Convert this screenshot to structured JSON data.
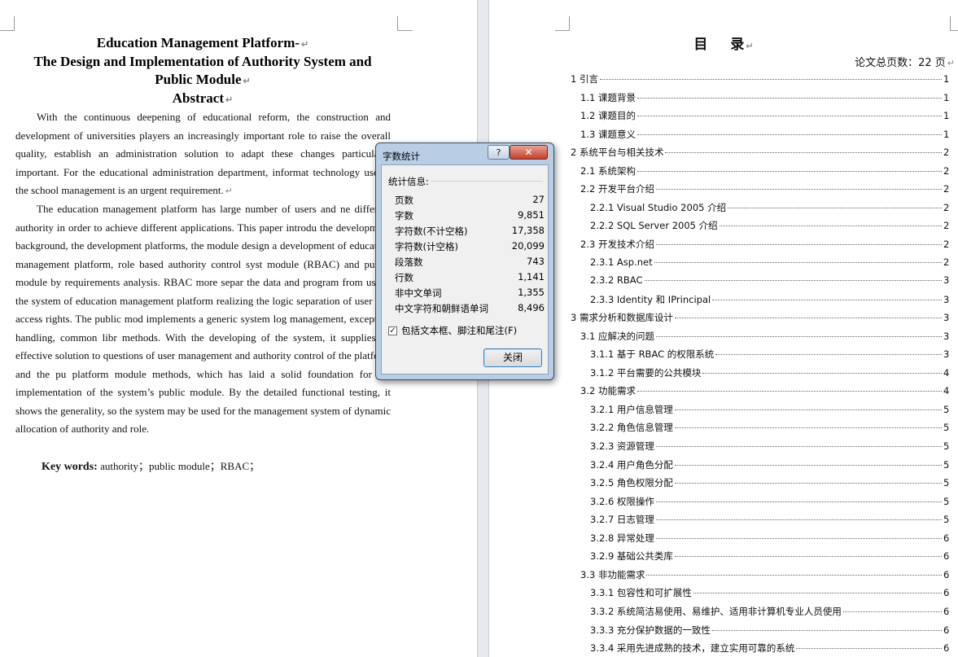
{
  "left_page": {
    "title_lines": [
      "Education Management Platform-",
      "The Design and Implementation of Authority System and",
      "Public Module"
    ],
    "abstract_heading": "Abstract",
    "paragraph1_lines": [
      "With the continuous deepening of educational reform, the construction and",
      "development of universities players an increasingly important role to raise the",
      "overall quality, establish an administration solution to adapt these changes",
      "particularly important. For the educational administration department, informat",
      "technology use in the school management is an urgent requirement."
    ],
    "paragraph2_lines": [
      "The education management platform has large number of users and ne",
      "different authority in order to achieve different applications. This paper introdu",
      "the development background, the development platforms, the module design a",
      "development of education management platform, role based authority control syst",
      "module (RBAC) and public module by requirements analysis. RBAC more separ",
      "the data and program from users, the system of education management platform",
      "realizing the logic separation of user and access rights. The public mod",
      "implements a generic system log management, exception handling, common libr",
      "methods. With the developing of the system, it supplies an effective solution to",
      "questions of user management and authority control of the platform and the pu",
      "platform module methods, which has laid a solid foundation for the implementation",
      "of the system’s public module. By the detailed functional testing, it shows the",
      "generality, so the system may be used for the management system of dynamic",
      "allocation of authority and role."
    ],
    "keywords_label": "Key words:",
    "keywords_value": "authority；public module；RBAC；"
  },
  "right_page": {
    "toc_title_a": "目",
    "toc_title_b": "录",
    "total_pages": "论文总页数：22 页",
    "toc": [
      {
        "label": "1 引言",
        "page": "1",
        "level": 0
      },
      {
        "label": "1.1 课题背景",
        "page": "1",
        "level": 1
      },
      {
        "label": "1.2 课题目的",
        "page": "1",
        "level": 1
      },
      {
        "label": "1.3 课题意义",
        "page": "1",
        "level": 1
      },
      {
        "label": "2 系统平台与相关技术",
        "page": "2",
        "level": 0
      },
      {
        "label": "2.1 系统架构",
        "page": "2",
        "level": 1
      },
      {
        "label": "2.2 开发平台介绍",
        "page": "2",
        "level": 1
      },
      {
        "label": "2.2.1 Visual Studio 2005 介绍",
        "page": "2",
        "level": 2
      },
      {
        "label": "2.2.2 SQL Server 2005 介绍",
        "page": "2",
        "level": 2
      },
      {
        "label": "2.3 开发技术介绍",
        "page": "2",
        "level": 1
      },
      {
        "label": "2.3.1 Asp.net",
        "page": "2",
        "level": 2
      },
      {
        "label": "2.3.2 RBAC",
        "page": "3",
        "level": 2
      },
      {
        "label": "2.3.3 Identity 和 IPrincipal",
        "page": "3",
        "level": 2
      },
      {
        "label": "3 需求分析和数据库设计",
        "page": "3",
        "level": 0
      },
      {
        "label": "3.1 应解决的问题",
        "page": "3",
        "level": 1
      },
      {
        "label": "3.1.1 基于 RBAC 的权限系统",
        "page": "3",
        "level": 2
      },
      {
        "label": "3.1.2 平台需要的公共模块",
        "page": "4",
        "level": 2
      },
      {
        "label": "3.2 功能需求",
        "page": "4",
        "level": 1
      },
      {
        "label": "3.2.1 用户信息管理",
        "page": "5",
        "level": 2
      },
      {
        "label": "3.2.2 角色信息管理",
        "page": "5",
        "level": 2
      },
      {
        "label": "3.2.3 资源管理",
        "page": "5",
        "level": 2
      },
      {
        "label": "3.2.4 用户角色分配",
        "page": "5",
        "level": 2
      },
      {
        "label": "3.2.5 角色权限分配",
        "page": "5",
        "level": 2
      },
      {
        "label": "3.2.6 权限操作",
        "page": "5",
        "level": 2
      },
      {
        "label": "3.2.7 日志管理",
        "page": "5",
        "level": 2
      },
      {
        "label": "3.2.8 异常处理",
        "page": "6",
        "level": 2
      },
      {
        "label": "3.2.9 基础公共类库",
        "page": "6",
        "level": 2
      },
      {
        "label": "3.3 非功能需求",
        "page": "6",
        "level": 1
      },
      {
        "label": "3.3.1 包容性和可扩展性",
        "page": "6",
        "level": 2
      },
      {
        "label": "3.3.2 系统简洁易使用、易维护、适用非计算机专业人员使用",
        "page": "6",
        "level": 2
      },
      {
        "label": "3.3.3 充分保护数据的一致性",
        "page": "6",
        "level": 2
      },
      {
        "label": "3.3.4 采用先进成熟的技术，建立实用可靠的系统",
        "page": "6",
        "level": 2
      }
    ]
  },
  "dialog": {
    "title": "字数统计",
    "help_label": "?",
    "close_x_label": "✕",
    "stats_heading": "统计信息:",
    "stats": [
      {
        "label": "页数",
        "value": "27"
      },
      {
        "label": "字数",
        "value": "9,851"
      },
      {
        "label": "字符数(不计空格)",
        "value": "17,358"
      },
      {
        "label": "字符数(计空格)",
        "value": "20,099"
      },
      {
        "label": "段落数",
        "value": "743"
      },
      {
        "label": "行数",
        "value": "1,141"
      },
      {
        "label": "非中文单词",
        "value": "1,355"
      },
      {
        "label": "中文字符和朝鲜语单词",
        "value": "8,496"
      }
    ],
    "include_label": "包括文本框、脚注和尾注(F)",
    "include_checked": true,
    "close_button": "关闭"
  }
}
